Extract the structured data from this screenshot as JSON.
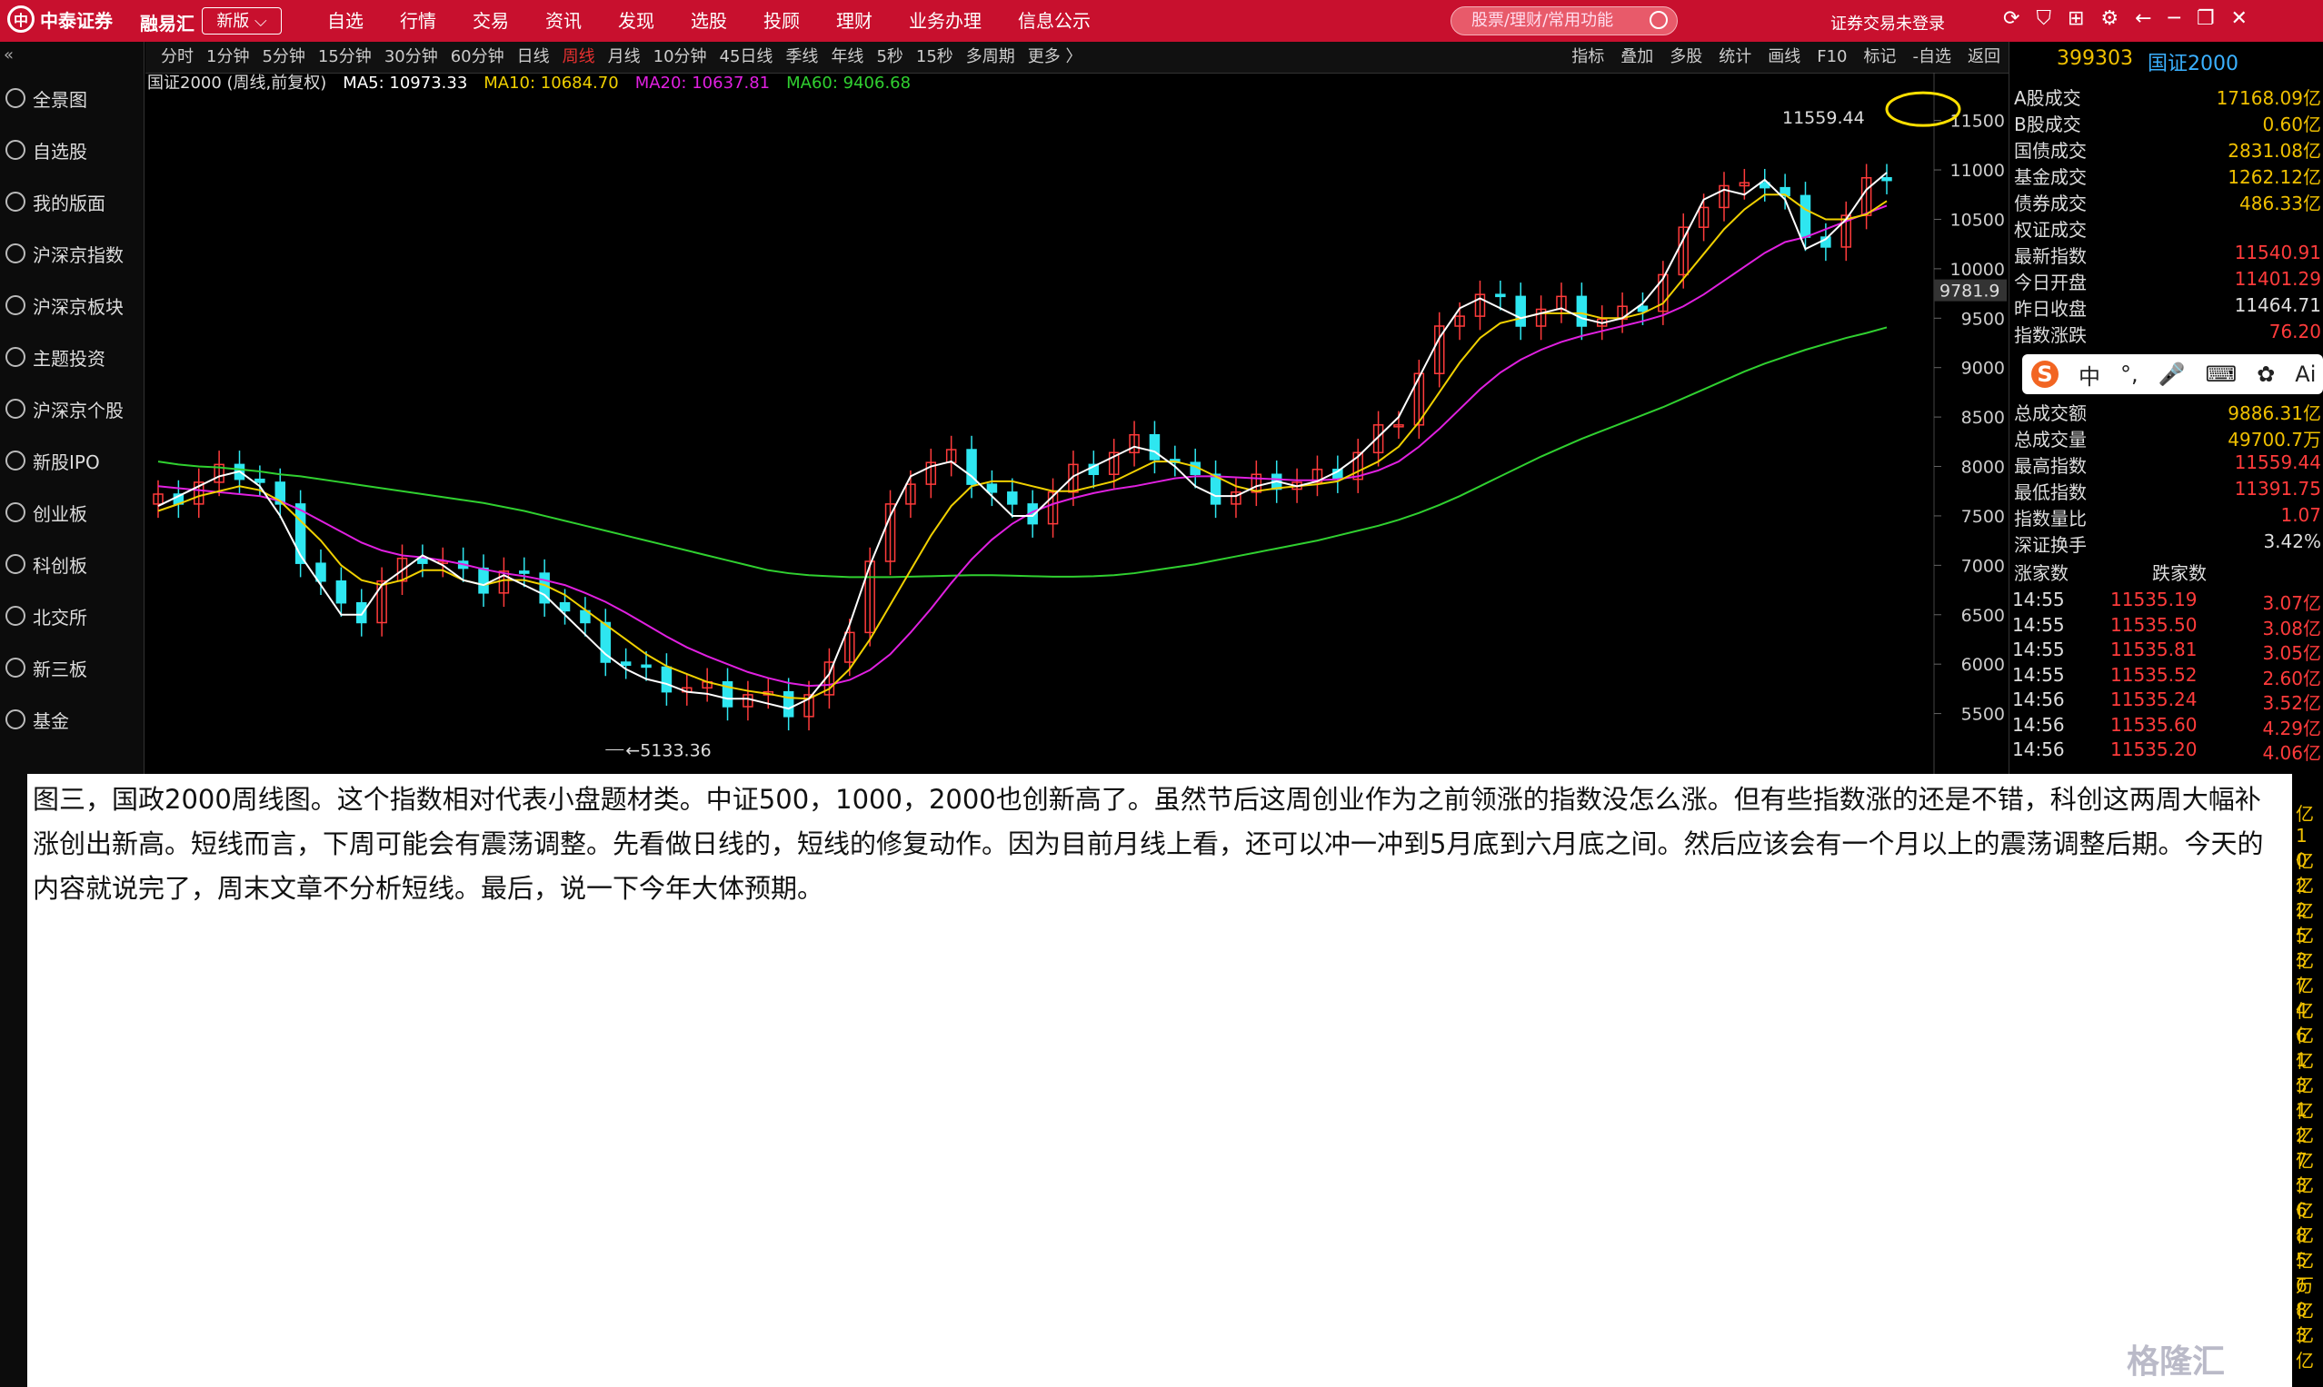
{
  "topbar": {
    "broker": "中泰证券",
    "app": "融易汇",
    "version": "新版",
    "menu": [
      "自选",
      "行情",
      "交易",
      "资讯",
      "发现",
      "选股",
      "投顾",
      "理财",
      "业务办理",
      "信息公示"
    ],
    "search_placeholder": "股票/理财/常用功能",
    "login_status": "证券交易未登录"
  },
  "toolbar": {
    "periods": [
      "分时",
      "1分钟",
      "5分钟",
      "15分钟",
      "30分钟",
      "60分钟",
      "日线",
      "周线",
      "月线",
      "10分钟",
      "45日线",
      "季线",
      "年线",
      "5秒",
      "15秒",
      "多周期",
      "更多 〉"
    ],
    "active_period": "周线",
    "tools": [
      "指标",
      "叠加",
      "多股",
      "统计",
      "画线",
      "F10",
      "标记",
      "-自选",
      "返回"
    ]
  },
  "sidebar": {
    "items": [
      "全景图",
      "自选股",
      "我的版面",
      "沪深京指数",
      "沪深京板块",
      "主题投资",
      "沪深京个股",
      "新股IPO",
      "创业板",
      "科创板",
      "北交所",
      "新三板",
      "基金"
    ]
  },
  "chart_header": {
    "name": "国证2000 (周线,前复权)",
    "ma5": "MA5: 10973.33",
    "ma10": "MA10: 10684.70",
    "ma20": "MA20: 10637.81",
    "ma60": "MA60: 9406.68"
  },
  "colors": {
    "up": "#ff3b3b",
    "down": "#2ee6f0",
    "ma5": "#ffffff",
    "ma10": "#f0d000",
    "ma20": "#e020e0",
    "ma60": "#30d030"
  },
  "chart_data": {
    "type": "candlestick",
    "title": "国证2000 (周线,前复权)",
    "ylim": [
      5000,
      11800
    ],
    "yticks": [
      5500,
      6000,
      6500,
      7000,
      7500,
      8000,
      8500,
      9000,
      9500,
      10000,
      10500,
      11000,
      11500
    ],
    "current_price_label": "9781.9",
    "high_label": "11559.44",
    "low_label": "5133.36",
    "ma5": [
      7600,
      7700,
      7800,
      7900,
      7950,
      7800,
      7500,
      7100,
      6800,
      6500,
      6500,
      6800,
      6950,
      7100,
      7000,
      6850,
      6800,
      6900,
      6800,
      6700,
      6500,
      6300,
      6100,
      5950,
      5850,
      5800,
      5720,
      5700,
      5650,
      5650,
      5600,
      5550,
      5650,
      5900,
      6400,
      7000,
      7500,
      7900,
      8000,
      8050,
      7900,
      7700,
      7500,
      7500,
      7700,
      7900,
      8000,
      8100,
      8200,
      8150,
      8000,
      7800,
      7700,
      7700,
      7800,
      7850,
      7800,
      7850,
      7950,
      8100,
      8300,
      8500,
      8900,
      9300,
      9600,
      9700,
      9600,
      9500,
      9550,
      9600,
      9500,
      9450,
      9500,
      9650,
      9900,
      10300,
      10700,
      10800,
      10750,
      10900,
      10700,
      10200,
      10300,
      10500,
      10800,
      10973
    ],
    "ma10": [
      7550,
      7620,
      7700,
      7750,
      7800,
      7760,
      7650,
      7450,
      7250,
      7000,
      6850,
      6800,
      6850,
      6950,
      6950,
      6850,
      6800,
      6850,
      6850,
      6800,
      6700,
      6550,
      6400,
      6250,
      6100,
      5980,
      5900,
      5820,
      5770,
      5730,
      5700,
      5660,
      5650,
      5750,
      5950,
      6250,
      6600,
      6950,
      7300,
      7600,
      7800,
      7850,
      7850,
      7800,
      7750,
      7750,
      7800,
      7850,
      7950,
      8050,
      8050,
      8000,
      7900,
      7800,
      7750,
      7780,
      7800,
      7820,
      7850,
      7950,
      8050,
      8200,
      8450,
      8750,
      9050,
      9300,
      9450,
      9500,
      9550,
      9550,
      9550,
      9500,
      9500,
      9550,
      9650,
      9900,
      10150,
      10400,
      10600,
      10750,
      10750,
      10600,
      10500,
      10500,
      10550,
      10685
    ],
    "ma20": [
      7800,
      7780,
      7760,
      7740,
      7720,
      7700,
      7650,
      7560,
      7450,
      7340,
      7230,
      7150,
      7100,
      7080,
      7050,
      7010,
      6960,
      6920,
      6890,
      6850,
      6800,
      6720,
      6630,
      6520,
      6400,
      6280,
      6170,
      6080,
      6000,
      5920,
      5860,
      5810,
      5780,
      5790,
      5840,
      5940,
      6100,
      6320,
      6560,
      6820,
      7060,
      7260,
      7420,
      7540,
      7620,
      7680,
      7730,
      7770,
      7800,
      7840,
      7880,
      7900,
      7900,
      7890,
      7880,
      7870,
      7860,
      7860,
      7870,
      7900,
      7960,
      8050,
      8200,
      8380,
      8580,
      8780,
      8950,
      9080,
      9180,
      9260,
      9320,
      9370,
      9420,
      9470,
      9530,
      9620,
      9740,
      9880,
      10020,
      10160,
      10270,
      10320,
      10400,
      10480,
      10560,
      10638
    ],
    "ma60": [
      8050,
      8020,
      8000,
      7990,
      7970,
      7950,
      7920,
      7900,
      7870,
      7840,
      7810,
      7780,
      7750,
      7720,
      7690,
      7660,
      7630,
      7590,
      7550,
      7500,
      7450,
      7400,
      7350,
      7300,
      7250,
      7200,
      7150,
      7100,
      7050,
      7000,
      6950,
      6920,
      6900,
      6890,
      6880,
      6880,
      6880,
      6885,
      6890,
      6895,
      6900,
      6900,
      6895,
      6890,
      6885,
      6885,
      6890,
      6900,
      6920,
      6950,
      6980,
      7010,
      7050,
      7090,
      7130,
      7170,
      7210,
      7250,
      7300,
      7350,
      7400,
      7460,
      7530,
      7610,
      7700,
      7800,
      7900,
      8000,
      8100,
      8190,
      8280,
      8360,
      8440,
      8520,
      8600,
      8690,
      8780,
      8870,
      8960,
      9040,
      9110,
      9180,
      9240,
      9300,
      9350,
      9407
    ]
  },
  "right_panel": {
    "code": "399303",
    "name": "国证2000",
    "rows": [
      {
        "k": "A股成交",
        "v": "17168.09亿",
        "c": "yel"
      },
      {
        "k": "B股成交",
        "v": "0.60亿",
        "c": "yel"
      },
      {
        "k": "国债成交",
        "v": "2831.08亿",
        "c": "yel"
      },
      {
        "k": "基金成交",
        "v": "1262.12亿",
        "c": "yel"
      },
      {
        "k": "债券成交",
        "v": "486.33亿",
        "c": "yel"
      },
      {
        "k": "权证成交",
        "v": "",
        "c": "yel"
      },
      {
        "k": "最新指数",
        "v": "11540.91",
        "c": "red"
      },
      {
        "k": "今日开盘",
        "v": "11401.29",
        "c": "red"
      },
      {
        "k": "昨日收盘",
        "v": "11464.71",
        "c": "wht"
      },
      {
        "k": "指数涨跌",
        "v": "76.20",
        "c": "red"
      }
    ],
    "rows2": [
      {
        "k": "总成交额",
        "v": "9886.31亿",
        "c": "yel"
      },
      {
        "k": "总成交量",
        "v": "49700.7万",
        "c": "yel"
      },
      {
        "k": "最高指数",
        "v": "11559.44",
        "c": "red"
      },
      {
        "k": "最低指数",
        "v": "11391.75",
        "c": "red"
      },
      {
        "k": "指数量比",
        "v": "1.07",
        "c": "red"
      },
      {
        "k": "深证换手",
        "v": "3.42%",
        "c": "wht"
      }
    ],
    "updown_header": [
      "涨家数",
      "跌家数"
    ],
    "ticks": [
      {
        "t": "14:55",
        "p": "11535.19",
        "r": "3.07亿"
      },
      {
        "t": "14:55",
        "p": "11535.50",
        "r": "3.08亿"
      },
      {
        "t": "14:55",
        "p": "11535.81",
        "r": "3.05亿"
      },
      {
        "t": "14:55",
        "p": "11535.52",
        "r": "2.60亿"
      },
      {
        "t": "14:56",
        "p": "11535.24",
        "r": "3.52亿"
      },
      {
        "t": "14:56",
        "p": "11535.60",
        "r": "4.29亿"
      },
      {
        "t": "14:56",
        "p": "11535.20",
        "r": "4.06亿"
      }
    ]
  },
  "ime": {
    "items": [
      "S",
      "中",
      "°,",
      "🎤",
      "⌨",
      "✿",
      "Ai"
    ]
  },
  "article": {
    "text": "图三，国政2000周线图。这个指数相对代表小盘题材类。中证500，1000，2000也创新高了。虽然节后这周创业作为之前领涨的指数没怎么涨。但有些指数涨的还是不错，科创这两周大幅补涨创出新高。短线而言，下周可能会有震荡调整。先看做日线的，短线的修复动作。因为目前月线上看，还可以冲一冲到5月底到六月底之间。然后应该会有一个月以上的震荡调整后期。今天的内容就说完了，周末文章不分析短线。最后，说一下今年大体预期。"
  },
  "watermark": "格隆汇",
  "right_strip_values": [
    "亿",
    "1亿",
    "0亿",
    "2亿",
    "2亿",
    "5亿",
    "3亿",
    "7亿",
    "4亿",
    "6亿",
    "1亿",
    "3亿",
    "1亿",
    "2亿",
    "7亿",
    "3亿",
    "6亿",
    "8亿",
    "5万",
    "6亿",
    "8亿",
    "3亿"
  ]
}
